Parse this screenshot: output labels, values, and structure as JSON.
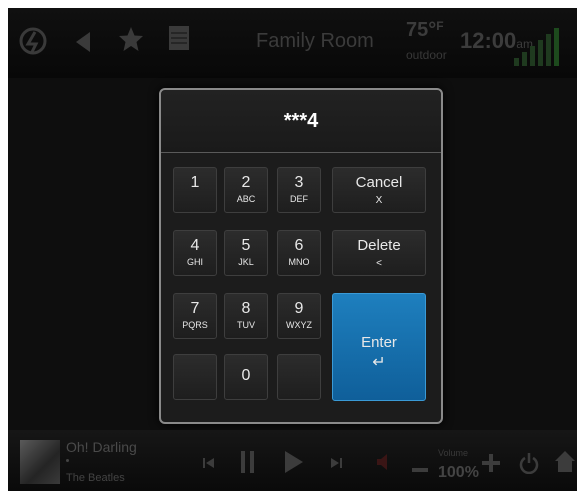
{
  "status_bar": {
    "room": "Family Room",
    "temperature": "75°",
    "temperature_unit": "F",
    "temperature_label": "outdoor",
    "time": "12:00",
    "time_suffix": "am",
    "icons": [
      "home-logo-icon",
      "back-arrow-icon",
      "favorite-star-icon",
      "keypad-icon",
      "signal-bars-icon"
    ]
  },
  "keypad": {
    "display": "***4",
    "keys": [
      {
        "label": "1",
        "sub": ""
      },
      {
        "label": "2",
        "sub": "ABC"
      },
      {
        "label": "3",
        "sub": "DEF"
      },
      {
        "label": "4",
        "sub": "GHI"
      },
      {
        "label": "5",
        "sub": "JKL"
      },
      {
        "label": "6",
        "sub": "MNO"
      },
      {
        "label": "7",
        "sub": "PQRS"
      },
      {
        "label": "8",
        "sub": "TUV"
      },
      {
        "label": "9",
        "sub": "WXYZ"
      },
      {
        "label": "",
        "sub": ""
      },
      {
        "label": "0",
        "sub": ""
      },
      {
        "label": "",
        "sub": ""
      }
    ],
    "cancel": {
      "label": "Cancel",
      "sub": "X"
    },
    "delete": {
      "label": "Delete",
      "sub": "<"
    },
    "enter": {
      "label": "Enter",
      "sub": "↵"
    },
    "enter_color": "#1a75b5"
  },
  "now_playing": {
    "song": "Oh! Darling",
    "artist": "The Beatles",
    "volume_label": "Volume",
    "volume_value": "100%",
    "icons": [
      "previous-icon",
      "pause-icon",
      "play-icon",
      "next-icon",
      "mute-icon",
      "volume-down-icon",
      "volume-up-icon",
      "power-icon",
      "home-icon"
    ]
  }
}
